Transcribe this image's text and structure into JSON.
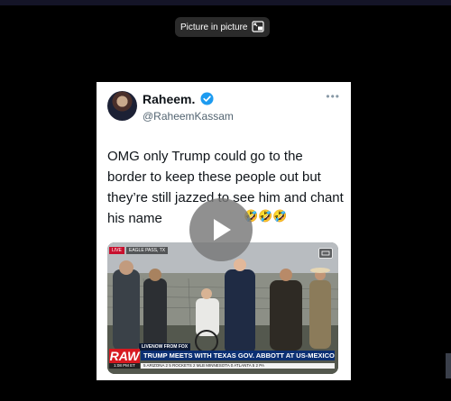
{
  "pip_button": {
    "label": "Picture in picture",
    "icon": "picture-in-picture-icon"
  },
  "tweet": {
    "name": "Raheem.",
    "handle": "@RaheemKassam",
    "text": "OMG only Trump could go to the border to keep these people out but they’re still jazzed to see him and chant his name",
    "emojis": "🤣🤣🤣",
    "more_icon": "more-icon"
  },
  "video": {
    "ticker_tag": "LIVE",
    "location": "EAGLE PASS, TX",
    "livenow": "LIVENOW FROM FOX",
    "raw_label": "RAW",
    "headline": "TRUMP MEETS WITH TEXAS GOV. ABBOTT AT US-MEXICO BORDER",
    "time": "1:08 PM ET",
    "scores": "5  ARIZONA  2  5  ROCKETS  2  MLB  MINNESOTA  0  ATLANTA  5  2  PA"
  },
  "colors": {
    "verified": "#1d9bf0",
    "raw": "#d71920",
    "headline": "#0b2f73"
  }
}
